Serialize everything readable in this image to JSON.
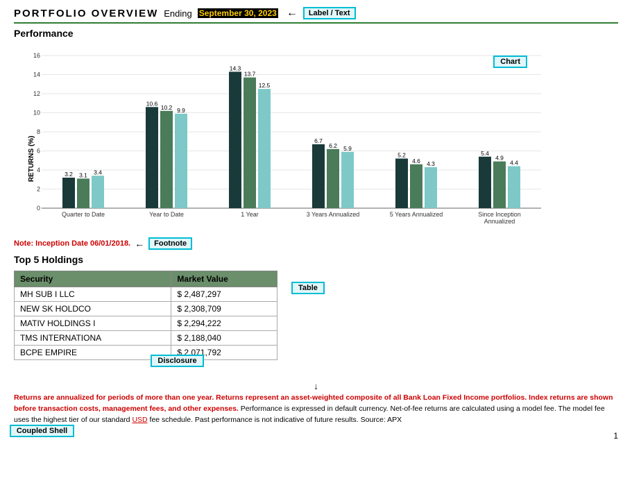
{
  "header": {
    "title": "PORTFOLIO OVERVIEW",
    "ending_label": "Ending",
    "date": "September 30, 2023",
    "label_badge": "Label / Text"
  },
  "performance": {
    "section_title": "Performance",
    "y_axis_label": "RETURNS (%)",
    "chart_badge": "Chart",
    "y_max": 16,
    "groups": [
      {
        "label": "Quarter to Date",
        "bars": [
          {
            "value": 3.2,
            "color": "#1a3a3a"
          },
          {
            "value": 3.1,
            "color": "#4a7c59"
          },
          {
            "value": 3.4,
            "color": "#7ec8c8"
          }
        ]
      },
      {
        "label": "Year to Date",
        "bars": [
          {
            "value": 10.6,
            "color": "#1a3a3a"
          },
          {
            "value": 10.2,
            "color": "#4a7c59"
          },
          {
            "value": 9.9,
            "color": "#7ec8c8"
          }
        ]
      },
      {
        "label": "1 Year",
        "bars": [
          {
            "value": 14.3,
            "color": "#1a3a3a"
          },
          {
            "value": 13.7,
            "color": "#4a7c59"
          },
          {
            "value": 12.5,
            "color": "#7ec8c8"
          }
        ]
      },
      {
        "label": "3 Years Annualized",
        "bars": [
          {
            "value": 6.7,
            "color": "#1a3a3a"
          },
          {
            "value": 6.2,
            "color": "#4a7c59"
          },
          {
            "value": 5.9,
            "color": "#7ec8c8"
          }
        ]
      },
      {
        "label": "5 Years Annualized",
        "bars": [
          {
            "value": 5.2,
            "color": "#1a3a3a"
          },
          {
            "value": 4.6,
            "color": "#4a7c59"
          },
          {
            "value": 4.3,
            "color": "#7ec8c8"
          }
        ]
      },
      {
        "label": "Since Inception\nAnnualized",
        "bars": [
          {
            "value": 5.4,
            "color": "#1a3a3a"
          },
          {
            "value": 4.9,
            "color": "#4a7c59"
          },
          {
            "value": 4.4,
            "color": "#7ec8c8"
          }
        ]
      }
    ]
  },
  "footnote": {
    "text": "Note: Inception Date 06/01/2018.",
    "badge": "Footnote"
  },
  "holdings": {
    "section_title": "Top 5 Holdings",
    "table_badge": "Table",
    "headers": [
      "Security",
      "Market Value"
    ],
    "rows": [
      [
        "MH SUB I LLC",
        "$ 2,487,297"
      ],
      [
        "NEW SK HOLDCO",
        "$ 2,308,709"
      ],
      [
        "MATIV HOLDINGS I",
        "$ 2,294,222"
      ],
      [
        "TMS INTERNATIONA",
        "$ 2,188,040"
      ],
      [
        "BCPE EMPIRE",
        "$ 2,071,792"
      ]
    ]
  },
  "disclosure": {
    "badge": "Disclosure",
    "red_part": "Returns are annualized for periods of more than one year. Returns represent an asset-weighted composite of all Bank Loan Fixed Income portfolios. Index returns are shown before transaction costs, management fees, and other expenses.",
    "normal_part1": " Performance is expressed in default currency. Net-of-fee returns are calculated using a model fee. The model fee uses the highest tier of our standard ",
    "usd": "USD",
    "normal_part2": " fee schedule. Past performance is not indicative of future results. Source: APX"
  },
  "coupled_shell": {
    "label": "Coupled Shell"
  },
  "page_number": "1"
}
